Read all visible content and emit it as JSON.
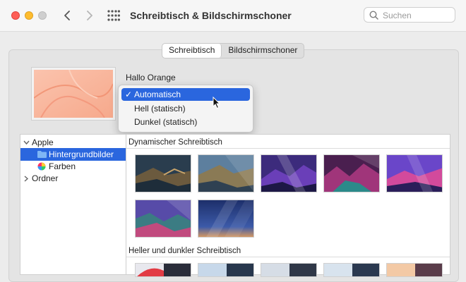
{
  "window": {
    "title": "Schreibtisch & Bildschirmschoner"
  },
  "search": {
    "placeholder": "Suchen",
    "value": ""
  },
  "tabs": [
    {
      "label": "Schreibtisch",
      "active": true
    },
    {
      "label": "Bildschirmschoner",
      "active": false
    }
  ],
  "current_wallpaper": {
    "name": "Hallo Orange"
  },
  "appearance_menu": {
    "selected": "Automatisch",
    "options": [
      "Automatisch",
      "Hell (statisch)",
      "Dunkel (statisch)"
    ]
  },
  "sidebar": {
    "groups": [
      {
        "label": "Apple",
        "expanded": true,
        "items": [
          {
            "label": "Hintergrundbilder",
            "selected": true
          },
          {
            "label": "Farben",
            "selected": false
          }
        ]
      },
      {
        "label": "Ordner",
        "expanded": false,
        "items": []
      }
    ]
  },
  "content": {
    "sections": [
      {
        "title": "Dynamischer Schreibtisch"
      },
      {
        "title": "Heller und dunkler Schreibtisch"
      }
    ]
  },
  "colors": {
    "accent": "#2a66de",
    "close": "#fe5f57",
    "minimize": "#febc2e"
  }
}
